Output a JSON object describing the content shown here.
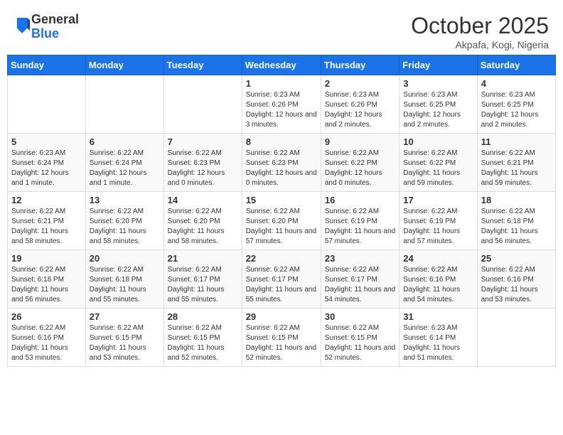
{
  "header": {
    "logo_general": "General",
    "logo_blue": "Blue",
    "month_title": "October 2025",
    "location": "Akpafa, Kogi, Nigeria"
  },
  "days_of_week": [
    "Sunday",
    "Monday",
    "Tuesday",
    "Wednesday",
    "Thursday",
    "Friday",
    "Saturday"
  ],
  "weeks": [
    [
      {
        "day": "",
        "info": ""
      },
      {
        "day": "",
        "info": ""
      },
      {
        "day": "",
        "info": ""
      },
      {
        "day": "1",
        "info": "Sunrise: 6:23 AM\nSunset: 6:26 PM\nDaylight: 12 hours and 3 minutes."
      },
      {
        "day": "2",
        "info": "Sunrise: 6:23 AM\nSunset: 6:26 PM\nDaylight: 12 hours and 2 minutes."
      },
      {
        "day": "3",
        "info": "Sunrise: 6:23 AM\nSunset: 6:25 PM\nDaylight: 12 hours and 2 minutes."
      },
      {
        "day": "4",
        "info": "Sunrise: 6:23 AM\nSunset: 6:25 PM\nDaylight: 12 hours and 2 minutes."
      }
    ],
    [
      {
        "day": "5",
        "info": "Sunrise: 6:23 AM\nSunset: 6:24 PM\nDaylight: 12 hours and 1 minute."
      },
      {
        "day": "6",
        "info": "Sunrise: 6:22 AM\nSunset: 6:24 PM\nDaylight: 12 hours and 1 minute."
      },
      {
        "day": "7",
        "info": "Sunrise: 6:22 AM\nSunset: 6:23 PM\nDaylight: 12 hours and 0 minutes."
      },
      {
        "day": "8",
        "info": "Sunrise: 6:22 AM\nSunset: 6:23 PM\nDaylight: 12 hours and 0 minutes."
      },
      {
        "day": "9",
        "info": "Sunrise: 6:22 AM\nSunset: 6:22 PM\nDaylight: 12 hours and 0 minutes."
      },
      {
        "day": "10",
        "info": "Sunrise: 6:22 AM\nSunset: 6:22 PM\nDaylight: 11 hours and 59 minutes."
      },
      {
        "day": "11",
        "info": "Sunrise: 6:22 AM\nSunset: 6:21 PM\nDaylight: 11 hours and 59 minutes."
      }
    ],
    [
      {
        "day": "12",
        "info": "Sunrise: 6:22 AM\nSunset: 6:21 PM\nDaylight: 11 hours and 58 minutes."
      },
      {
        "day": "13",
        "info": "Sunrise: 6:22 AM\nSunset: 6:20 PM\nDaylight: 11 hours and 58 minutes."
      },
      {
        "day": "14",
        "info": "Sunrise: 6:22 AM\nSunset: 6:20 PM\nDaylight: 11 hours and 58 minutes."
      },
      {
        "day": "15",
        "info": "Sunrise: 6:22 AM\nSunset: 6:20 PM\nDaylight: 11 hours and 57 minutes."
      },
      {
        "day": "16",
        "info": "Sunrise: 6:22 AM\nSunset: 6:19 PM\nDaylight: 11 hours and 57 minutes."
      },
      {
        "day": "17",
        "info": "Sunrise: 6:22 AM\nSunset: 6:19 PM\nDaylight: 11 hours and 57 minutes."
      },
      {
        "day": "18",
        "info": "Sunrise: 6:22 AM\nSunset: 6:18 PM\nDaylight: 11 hours and 56 minutes."
      }
    ],
    [
      {
        "day": "19",
        "info": "Sunrise: 6:22 AM\nSunset: 6:18 PM\nDaylight: 11 hours and 56 minutes."
      },
      {
        "day": "20",
        "info": "Sunrise: 6:22 AM\nSunset: 6:18 PM\nDaylight: 11 hours and 55 minutes."
      },
      {
        "day": "21",
        "info": "Sunrise: 6:22 AM\nSunset: 6:17 PM\nDaylight: 11 hours and 55 minutes."
      },
      {
        "day": "22",
        "info": "Sunrise: 6:22 AM\nSunset: 6:17 PM\nDaylight: 11 hours and 55 minutes."
      },
      {
        "day": "23",
        "info": "Sunrise: 6:22 AM\nSunset: 6:17 PM\nDaylight: 11 hours and 54 minutes."
      },
      {
        "day": "24",
        "info": "Sunrise: 6:22 AM\nSunset: 6:16 PM\nDaylight: 11 hours and 54 minutes."
      },
      {
        "day": "25",
        "info": "Sunrise: 6:22 AM\nSunset: 6:16 PM\nDaylight: 11 hours and 53 minutes."
      }
    ],
    [
      {
        "day": "26",
        "info": "Sunrise: 6:22 AM\nSunset: 6:16 PM\nDaylight: 11 hours and 53 minutes."
      },
      {
        "day": "27",
        "info": "Sunrise: 6:22 AM\nSunset: 6:15 PM\nDaylight: 11 hours and 53 minutes."
      },
      {
        "day": "28",
        "info": "Sunrise: 6:22 AM\nSunset: 6:15 PM\nDaylight: 11 hours and 52 minutes."
      },
      {
        "day": "29",
        "info": "Sunrise: 6:22 AM\nSunset: 6:15 PM\nDaylight: 11 hours and 52 minutes."
      },
      {
        "day": "30",
        "info": "Sunrise: 6:22 AM\nSunset: 6:15 PM\nDaylight: 11 hours and 52 minutes."
      },
      {
        "day": "31",
        "info": "Sunrise: 6:23 AM\nSunset: 6:14 PM\nDaylight: 11 hours and 51 minutes."
      },
      {
        "day": "",
        "info": ""
      }
    ]
  ]
}
